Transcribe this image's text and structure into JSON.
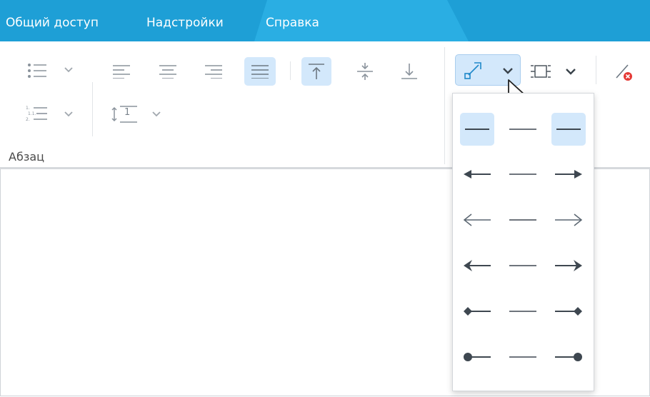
{
  "menu": {
    "tabs": [
      "Общий доступ",
      "Надстройки",
      "Справка"
    ]
  },
  "paragraph_group": {
    "label": "Абзац",
    "line_spacing_value": "1"
  },
  "line_ends_dropdown": {
    "options": [
      "no-ends",
      "line",
      "no-ends",
      "filled-arrow-start",
      "line",
      "filled-arrow-end",
      "open-arrow-start",
      "line",
      "open-arrow-end",
      "stealth-arrow-start",
      "line",
      "stealth-arrow-end",
      "diamond-start",
      "line",
      "diamond-end",
      "circle-start",
      "line",
      "circle-end"
    ]
  },
  "colors": {
    "menubar": "#1e9fd6",
    "selected": "#d3e8fb",
    "icon": "#5a6570",
    "accent": "#1e88c9",
    "clear_red": "#e53935"
  }
}
